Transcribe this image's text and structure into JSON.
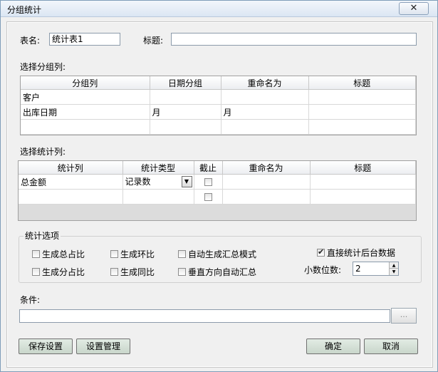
{
  "window": {
    "title": "分组统计",
    "close_icon": "close-icon"
  },
  "header": {
    "table_name_label": "表名:",
    "table_name_value": "统计表1",
    "title_label": "标题:",
    "title_value": ""
  },
  "group_section": {
    "label": "选择分组列:",
    "columns": [
      "分组列",
      "日期分组",
      "重命名为",
      "标题"
    ],
    "rows": [
      [
        "客户",
        "",
        "",
        ""
      ],
      [
        "出库日期",
        "月",
        "月",
        ""
      ],
      [
        "",
        "",
        "",
        ""
      ]
    ]
  },
  "stat_section": {
    "label": "选择统计列:",
    "columns": [
      "统计列",
      "统计类型",
      "截止",
      "重命名为",
      "标题"
    ],
    "rows": [
      {
        "column": "总金额",
        "type": "记录数",
        "cutoff": false,
        "rename": "",
        "title": ""
      },
      {
        "column": "",
        "type": "",
        "cutoff": false,
        "rename": "",
        "title": ""
      }
    ]
  },
  "options": {
    "legend": "统计选项",
    "items": {
      "total_share": {
        "label": "生成总占比",
        "checked": false
      },
      "ring_ratio": {
        "label": "生成环比",
        "checked": false
      },
      "auto_summary_mode": {
        "label": "自动生成汇总模式",
        "checked": false
      },
      "sub_share": {
        "label": "生成分占比",
        "checked": false
      },
      "yoy_ratio": {
        "label": "生成同比",
        "checked": false
      },
      "vertical_auto_summary": {
        "label": "垂直方向自动汇总",
        "checked": false
      },
      "direct_backend": {
        "label": "直接统计后台数据",
        "checked": true
      }
    },
    "decimals_label": "小数位数:",
    "decimals_value": "2"
  },
  "condition": {
    "label": "条件:",
    "value": "",
    "browse_label": "..."
  },
  "buttons": {
    "save_settings": "保存设置",
    "manage_settings": "设置管理",
    "ok": "确定",
    "cancel": "取消"
  }
}
